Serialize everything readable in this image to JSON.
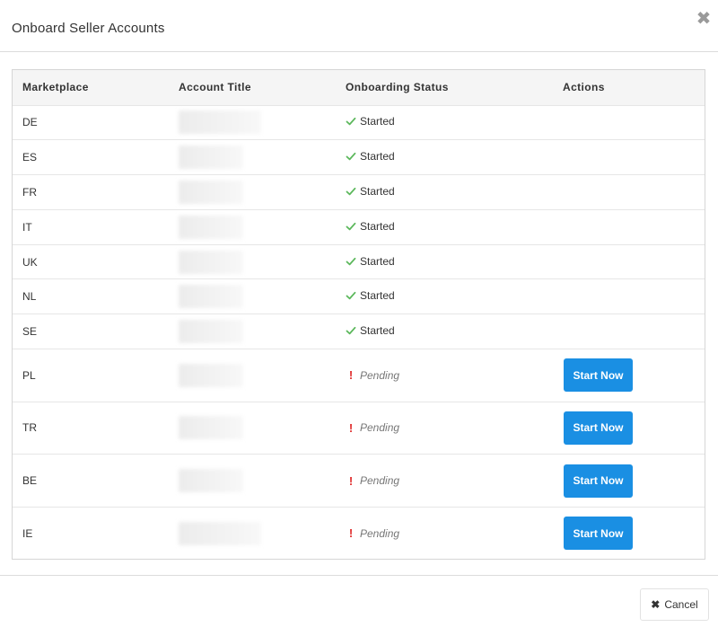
{
  "modal": {
    "title": "Onboard Seller Accounts",
    "close_icon": "close-icon",
    "cancel_label": "Cancel"
  },
  "table": {
    "headers": [
      "Marketplace",
      "Account Title",
      "Onboarding Status",
      "Actions"
    ],
    "rows": [
      {
        "marketplace": "DE",
        "status": "Started",
        "action": ""
      },
      {
        "marketplace": "ES",
        "status": "Started",
        "action": ""
      },
      {
        "marketplace": "FR",
        "status": "Started",
        "action": ""
      },
      {
        "marketplace": "IT",
        "status": "Started",
        "action": ""
      },
      {
        "marketplace": "UK",
        "status": "Started",
        "action": ""
      },
      {
        "marketplace": "NL",
        "status": "Started",
        "action": ""
      },
      {
        "marketplace": "SE",
        "status": "Started",
        "action": ""
      },
      {
        "marketplace": "PL",
        "status": "Pending",
        "action": "Start Now"
      },
      {
        "marketplace": "TR",
        "status": "Pending",
        "action": "Start Now"
      },
      {
        "marketplace": "BE",
        "status": "Pending",
        "action": "Start Now"
      },
      {
        "marketplace": "IE",
        "status": "Pending",
        "action": "Start Now"
      }
    ]
  },
  "colors": {
    "accent": "#1a8fe3",
    "started_check": "#5cb85c",
    "pending_mark": "#e02d2d"
  }
}
